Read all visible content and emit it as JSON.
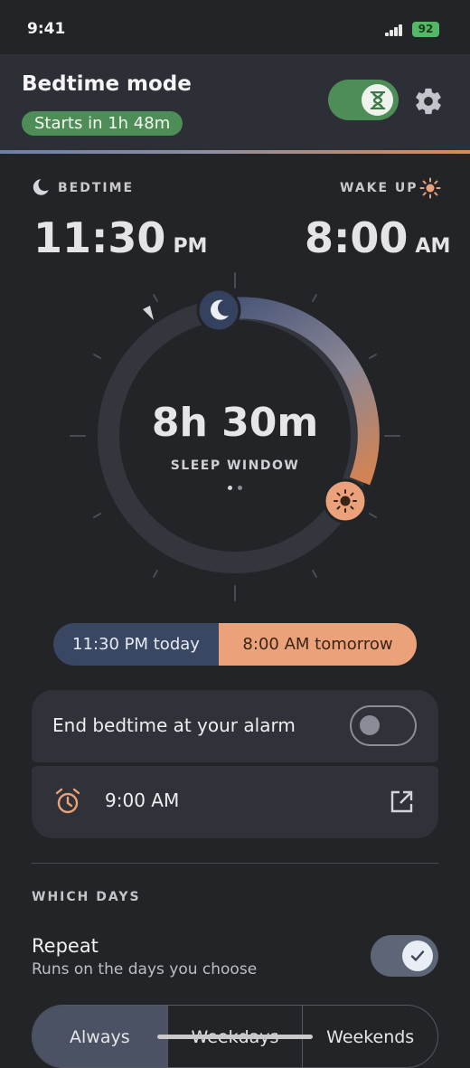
{
  "status_bar": {
    "time": "9:41",
    "battery": "92"
  },
  "header": {
    "title": "Bedtime mode",
    "starts_in": "Starts in 1h 48m"
  },
  "schedule": {
    "bedtime_label": "BEDTIME",
    "wakeup_label": "WAKE UP",
    "bedtime": "11:30",
    "bedtime_ampm": "PM",
    "wakeup": "8:00",
    "wakeup_ampm": "AM"
  },
  "dial": {
    "duration": "8h 30m",
    "caption": "SLEEP WINDOW"
  },
  "range": {
    "start": "11:30 PM today",
    "end": "8:00 AM tomorrow"
  },
  "alarm_card": {
    "end_label": "End bedtime at your alarm",
    "alarm_time": "9:00 AM"
  },
  "days": {
    "section_title": "WHICH DAYS",
    "repeat_title": "Repeat",
    "repeat_subtitle": "Runs on the days you choose",
    "options": [
      "Always",
      "Weekdays",
      "Weekends"
    ]
  },
  "colors": {
    "accent_green": "#4f8d58",
    "night": "#3a4763",
    "day": "#eba27a"
  }
}
